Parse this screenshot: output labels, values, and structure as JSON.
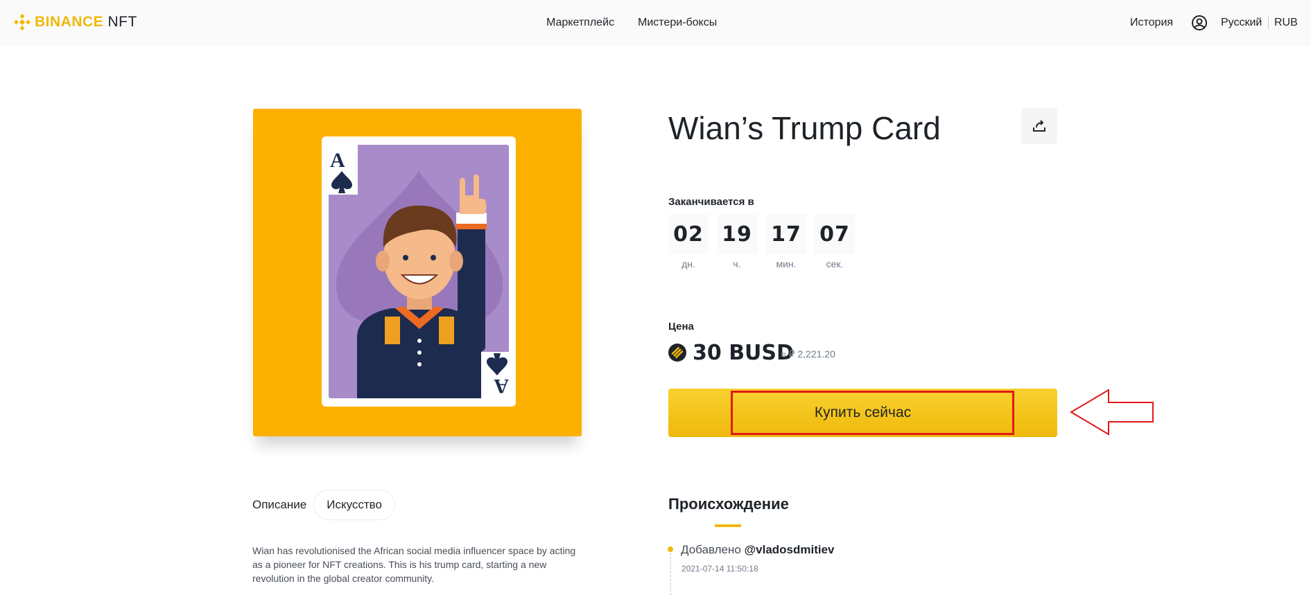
{
  "header": {
    "logo_brand": "BINANCE",
    "logo_suffix": "NFT",
    "nav": {
      "marketplace": "Маркетплейс",
      "mystery_boxes": "Мистери-боксы",
      "history": "История",
      "language": "Русский",
      "currency": "RUB"
    },
    "icons": {
      "logo": "binance-diamond-icon",
      "user": "user-circle-icon"
    }
  },
  "item": {
    "title": "Wian’s Trump Card",
    "share_icon": "share-icon",
    "artwork": "ace-of-spades-card-illustration",
    "card_rank": "A"
  },
  "countdown": {
    "label": "Заканчивается в",
    "units": [
      {
        "value": "02",
        "label": "дн."
      },
      {
        "value": "19",
        "label": "ч."
      },
      {
        "value": "17",
        "label": "мин."
      },
      {
        "value": "07",
        "label": "сек."
      }
    ]
  },
  "price": {
    "label": "Цена",
    "amount": "30 BUSD",
    "fiat": "≈ ₽ 2,221.20",
    "coin_icon": "busd-coin-icon"
  },
  "buy": {
    "label": "Купить сейчас"
  },
  "tabs": {
    "description": "Описание",
    "category": "Искусство"
  },
  "description": "Wian has revolutionised the African social media influencer space by acting as a pioneer for NFT creations. This is his trump card, starting a new revolution in the global creator community.",
  "provenance": {
    "title": "Происхождение",
    "entries": [
      {
        "action": "Добавлено",
        "user": "@vladosdmitiev",
        "time": "2021-07-14 11:50:18"
      }
    ]
  },
  "colors": {
    "brand": "#f0b90b",
    "artwork_bg": "#fcb100",
    "card_purple": "#a88bc9",
    "highlight": "#e11919"
  }
}
